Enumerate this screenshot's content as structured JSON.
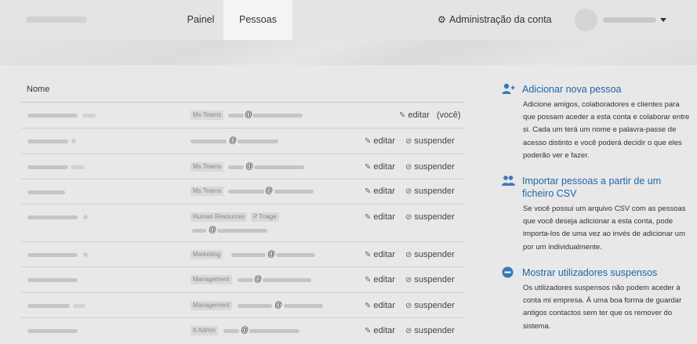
{
  "nav": {
    "tabs": [
      {
        "label": "Painel",
        "active": false
      },
      {
        "label": "Pessoas",
        "active": true
      }
    ],
    "admin_label": "Administração da conta"
  },
  "table": {
    "header_name": "Nome",
    "edit_label": "editar",
    "suspend_label": "suspender",
    "you_label": "(você)",
    "rows": [
      {
        "tags": [
          "Ms Teams"
        ],
        "is_you": true
      },
      {
        "tags": [],
        "is_you": false
      },
      {
        "tags": [
          "Ms Teams"
        ],
        "is_you": false
      },
      {
        "tags": [
          "Ms Teams"
        ],
        "is_you": false
      },
      {
        "tags": [
          "Human Resources",
          "P Triage"
        ],
        "is_you": false
      },
      {
        "tags": [
          "Marketing"
        ],
        "is_you": false
      },
      {
        "tags": [
          "Management"
        ],
        "is_you": false
      },
      {
        "tags": [
          "Management"
        ],
        "is_you": false
      },
      {
        "tags": [
          "It Admin"
        ],
        "is_you": false
      }
    ]
  },
  "sidebar": {
    "add": {
      "title": "Adicionar nova pessoa",
      "text": "Adicione amigos, colaboradores e clientes para que possam aceder a esta conta e colaborar entre si. Cada um terá um nome e palavra-passe de acesso distinto e você poderá decidir o que eles poderão ver e fazer."
    },
    "import": {
      "title": "Importar pessoas a partir de um ficheiro CSV",
      "text": "Se você possui um arquivo CSV com as pessoas que você deseja adicionar a esta conta, pode importa-los de uma vez ao invés de adicionar um por um individualmente."
    },
    "suspended": {
      "title": "Mostrar utilizadores suspensos",
      "text": "Os utilizadores suspensos não podem aceder à conta mi empresa. Á uma boa forma de guardar antigos contactos sem ter que os remover do sistema."
    }
  },
  "icons": {
    "gear": "gear-icon",
    "pencil": "pencil-icon",
    "suspend": "ban-icon",
    "add_person": "user-plus-icon",
    "import": "users-icon",
    "minus": "minus-circle-icon"
  },
  "colors": {
    "link": "#1f66a8",
    "icon_blue": "#3a78bd"
  }
}
